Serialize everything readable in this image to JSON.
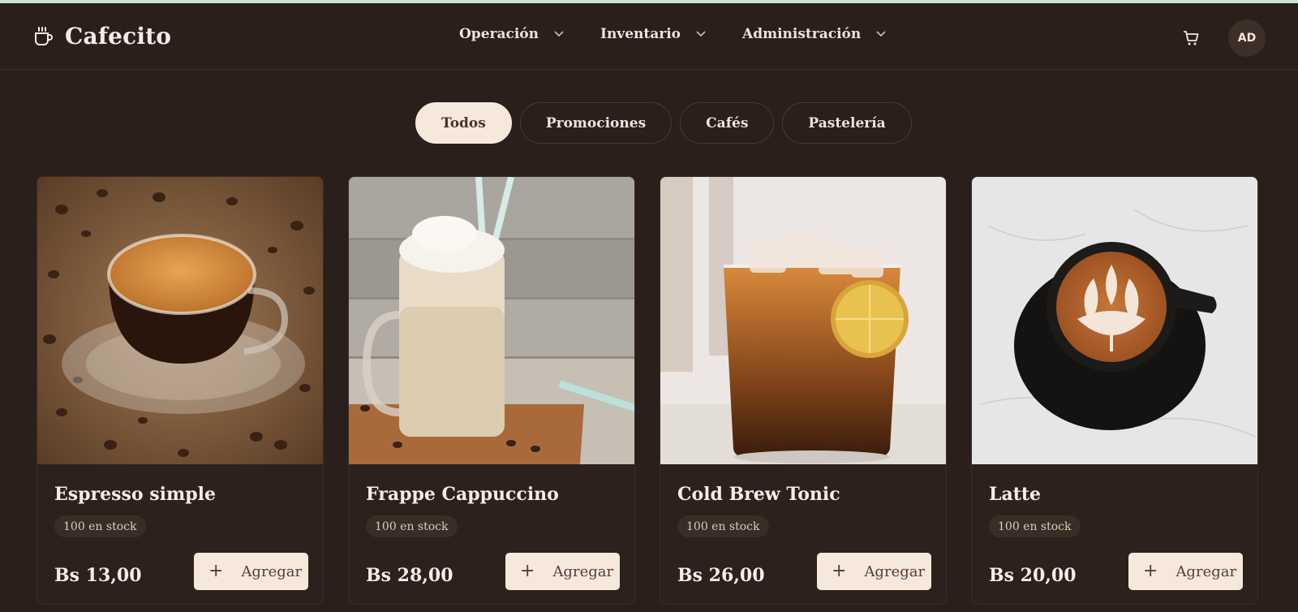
{
  "app": {
    "name": "Cafecito"
  },
  "nav": {
    "items": [
      {
        "label": "Operación"
      },
      {
        "label": "Inventario"
      },
      {
        "label": "Administración"
      }
    ]
  },
  "user": {
    "initials": "AD"
  },
  "filters": {
    "chips": [
      {
        "label": "Todos",
        "active": true
      },
      {
        "label": "Promociones",
        "active": false
      },
      {
        "label": "Cafés",
        "active": false
      },
      {
        "label": "Pastelería",
        "active": false
      }
    ]
  },
  "products": [
    {
      "name": "Espresso simple",
      "stock": "100 en stock",
      "price": "Bs 13,00",
      "add_label": "Agregar",
      "image": "espresso-cup-with-coffee-beans"
    },
    {
      "name": "Frappe Cappuccino",
      "stock": "100 en stock",
      "price": "Bs 28,00",
      "add_label": "Agregar",
      "image": "frappe-jar-with-straws"
    },
    {
      "name": "Cold Brew Tonic",
      "stock": "100 en stock",
      "price": "Bs 26,00",
      "add_label": "Agregar",
      "image": "iced-cold-brew-with-lime"
    },
    {
      "name": "Latte",
      "stock": "100 en stock",
      "price": "Bs 20,00",
      "add_label": "Agregar",
      "image": "latte-art-cup-top-view"
    }
  ],
  "colors": {
    "background": "#2a1f1a",
    "card": "#2c211c",
    "accent_light": "#f6e9dc",
    "accent_text": "#5a3d2e"
  }
}
